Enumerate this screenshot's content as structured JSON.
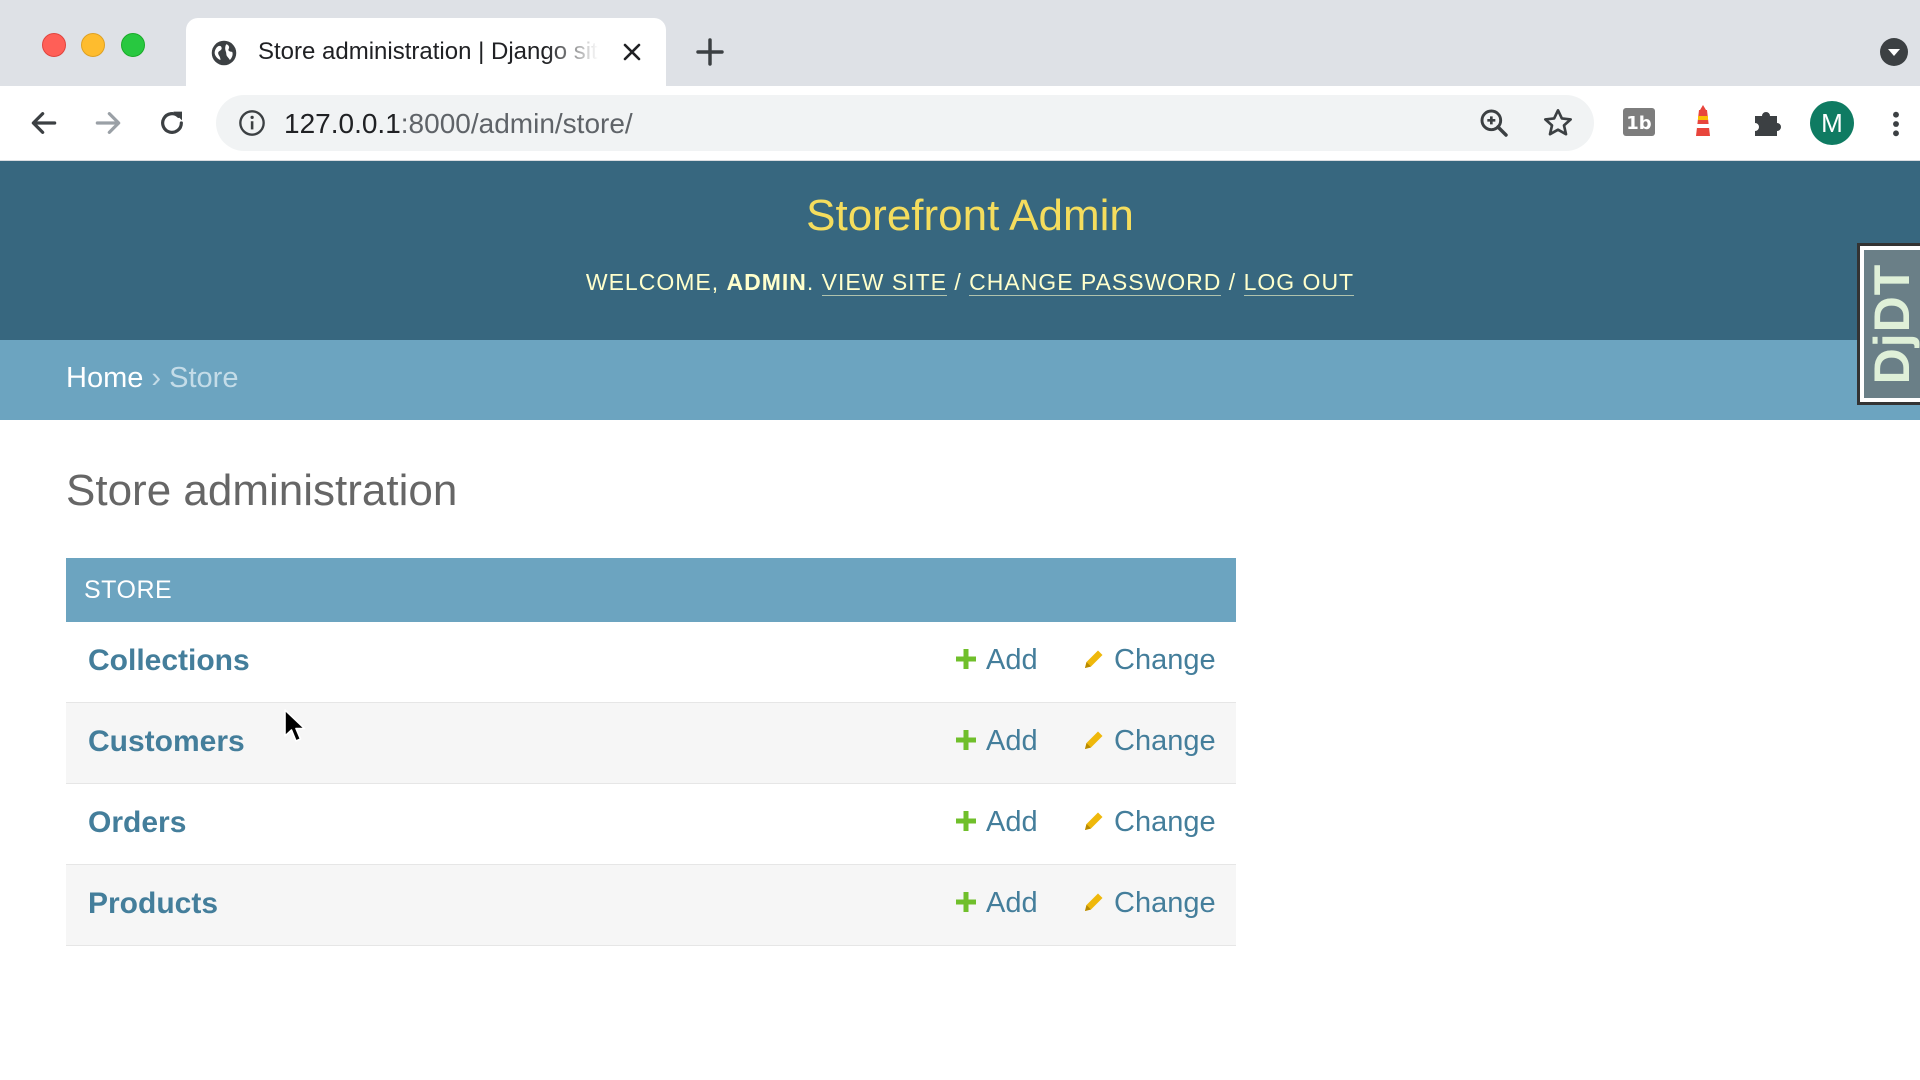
{
  "browser": {
    "tab_title": "Store administration | Django site admin",
    "url_host": "127.0.0.1",
    "url_rest": ":8000/admin/store/",
    "profile_initial": "M"
  },
  "header": {
    "branding": "Storefront Admin",
    "welcome": "Welcome, ",
    "username": "admin",
    "separator": ". ",
    "view_site": "View site",
    "slash": " / ",
    "change_password": "Change password",
    "log_out": "Log out"
  },
  "breadcrumbs": {
    "home": "Home",
    "separator": " › ",
    "current": "Store"
  },
  "djdt": {
    "label": "DjDT"
  },
  "content": {
    "title": "Store administration",
    "module_caption": "STORE",
    "add_label": "Add",
    "change_label": "Change",
    "models": [
      {
        "name": "Collections"
      },
      {
        "name": "Customers"
      },
      {
        "name": "Orders"
      },
      {
        "name": "Products"
      }
    ]
  },
  "colors": {
    "header_bg": "#37677f",
    "branding": "#f5dd5d",
    "breadcrumb_bg": "#6ca4c0",
    "link": "#447e9b",
    "add_icon": "#70bf2b",
    "change_icon": "#efb80b"
  },
  "icons": {
    "favicon": "globe-icon",
    "add": "plus-icon",
    "change": "pencil-icon"
  }
}
